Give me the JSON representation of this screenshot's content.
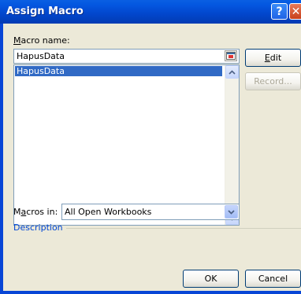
{
  "window": {
    "title": "Assign Macro",
    "help_glyph": "?",
    "close_glyph": "✕"
  },
  "macro_name": {
    "label_accel": "M",
    "label_rest": "acro name:",
    "value": "HapusData"
  },
  "macro_list": {
    "items": [
      {
        "label": "HapusData",
        "selected": true
      }
    ]
  },
  "buttons": {
    "edit_accel": "E",
    "edit_rest": "dit",
    "record": "Record...",
    "ok": "OK",
    "cancel": "Cancel"
  },
  "macros_in": {
    "label_pre": "M",
    "label_accel": "a",
    "label_rest": "cros in:",
    "selected": "All Open Workbooks"
  },
  "description": {
    "label": "Description"
  },
  "colors": {
    "accent": "#316ac5",
    "titlebar": "#0246cc",
    "dialog_bg": "#ece9d8"
  }
}
